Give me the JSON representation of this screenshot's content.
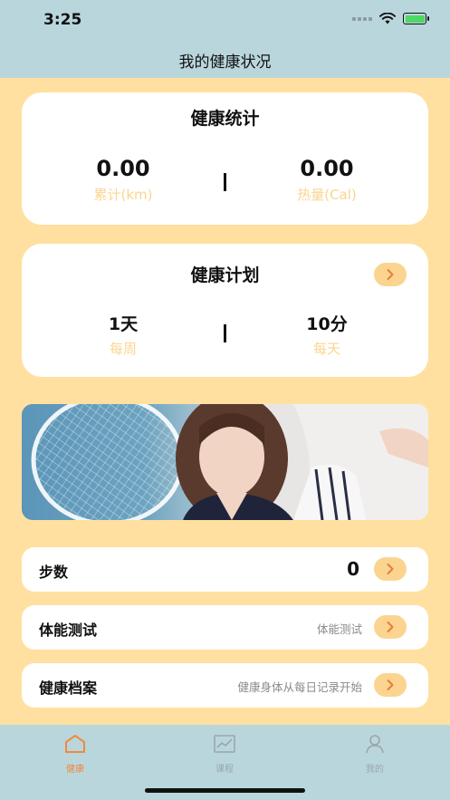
{
  "status_bar": {
    "time": "3:25"
  },
  "header": {
    "title": "我的健康状况"
  },
  "health_stats": {
    "title": "健康统计",
    "distance": {
      "value": "0.00",
      "label": "累计(km)"
    },
    "calories": {
      "value": "0.00",
      "label": "热量(Cal)"
    }
  },
  "health_plan": {
    "title": "健康计划",
    "weekly": {
      "value": "1天",
      "label": "每周"
    },
    "daily": {
      "value": "10分",
      "label": "每天"
    }
  },
  "rows": [
    {
      "label": "步数",
      "value": "0"
    },
    {
      "label": "体能测试",
      "hint": "体能测试"
    },
    {
      "label": "健康档案",
      "hint": "健康身体从每日记录开始"
    }
  ],
  "tabbar": {
    "tabs": [
      {
        "label": "健康",
        "active": true
      },
      {
        "label": "课程",
        "active": false
      },
      {
        "label": "我的",
        "active": false
      }
    ]
  },
  "colors": {
    "page_background": "#ffe0a0",
    "header_background": "#b9d6dd",
    "accent": "#fbd590",
    "arrow": "#e67e3a",
    "active_tab": "#f08a3a",
    "inactive_tab": "#9aa6aa"
  }
}
